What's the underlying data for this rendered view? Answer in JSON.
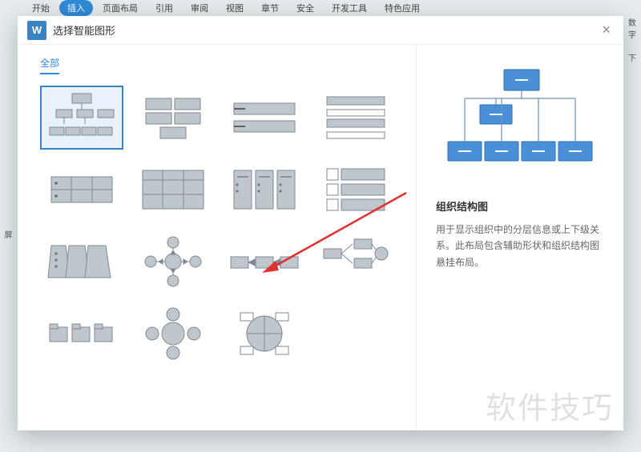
{
  "ribbon": {
    "tabs": [
      "开始",
      "插入",
      "页面布局",
      "引用",
      "审阅",
      "视图",
      "章节",
      "安全",
      "开发工具",
      "特色应用"
    ],
    "active_index": 1
  },
  "left_strip": "屏",
  "right_strip": {
    "a": "数字",
    "b": "下"
  },
  "dialog": {
    "logo_letter": "W",
    "title": "选择智能图形",
    "close": "×",
    "filter_label": "全部",
    "selected_index": 0,
    "thumbs": [
      {
        "name": "org-chart"
      },
      {
        "name": "stacked-rows"
      },
      {
        "name": "two-bars"
      },
      {
        "name": "header-list"
      },
      {
        "name": "table-3x2"
      },
      {
        "name": "table-3x3"
      },
      {
        "name": "note-cols"
      },
      {
        "name": "icon-list"
      },
      {
        "name": "pyramid-steps"
      },
      {
        "name": "hub-spoke"
      },
      {
        "name": "process-3"
      },
      {
        "name": "flow-branch"
      },
      {
        "name": "folder-tabs"
      },
      {
        "name": "circle-4"
      },
      {
        "name": "pie-matrix"
      }
    ],
    "preview": {
      "name": "组织结构图",
      "description": "用于显示组织中的分层信息或上下级关系。此布局包含辅助形状和组织结构图悬挂布局。"
    }
  },
  "watermark": "软件技巧"
}
